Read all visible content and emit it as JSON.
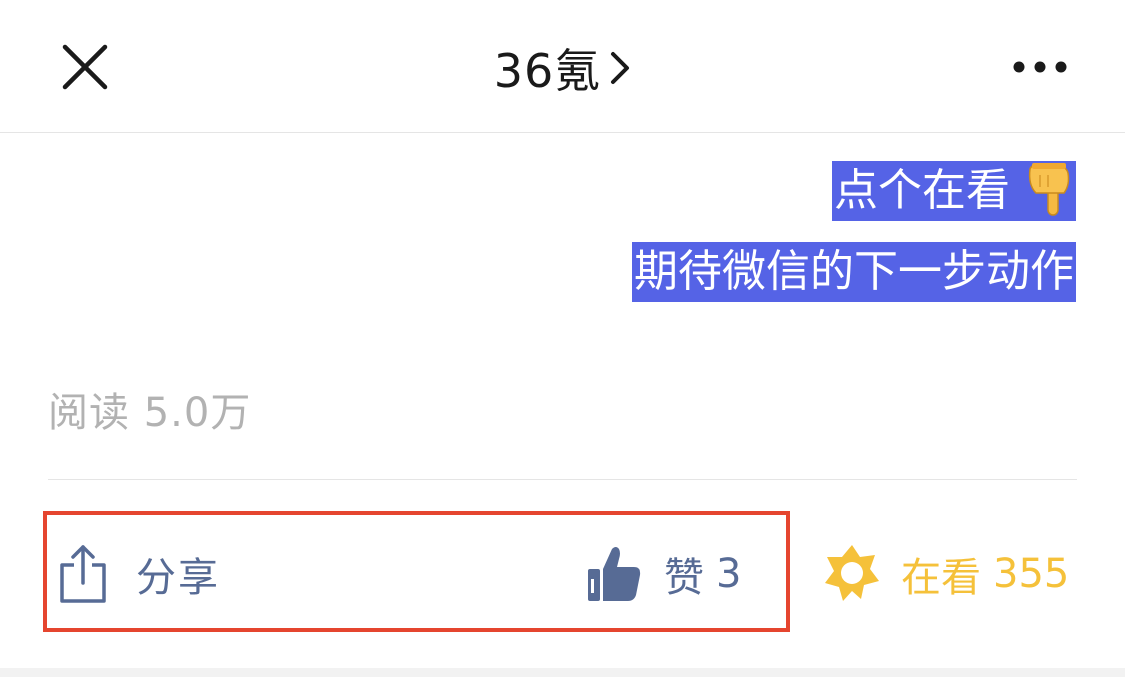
{
  "header": {
    "title": "36氪",
    "close_icon": "close-icon",
    "chevron_icon": "chevron-right-icon",
    "more_icon": "more-icon"
  },
  "article": {
    "highlight_line1": "点个在看",
    "highlight_line1_emoji": "pointing-down-hand-icon",
    "highlight_line2": "期待微信的下一步动作",
    "highlight_color": "#5563e6",
    "read_label": "阅读",
    "read_count": "5.0万"
  },
  "actions": {
    "share_label": "分享",
    "like_label": "赞",
    "like_count": "3",
    "wow_label": "在看",
    "wow_count": "355",
    "link_color": "#576b95",
    "wow_color": "#f5c13a",
    "annotation_box_color": "#e5452f"
  }
}
